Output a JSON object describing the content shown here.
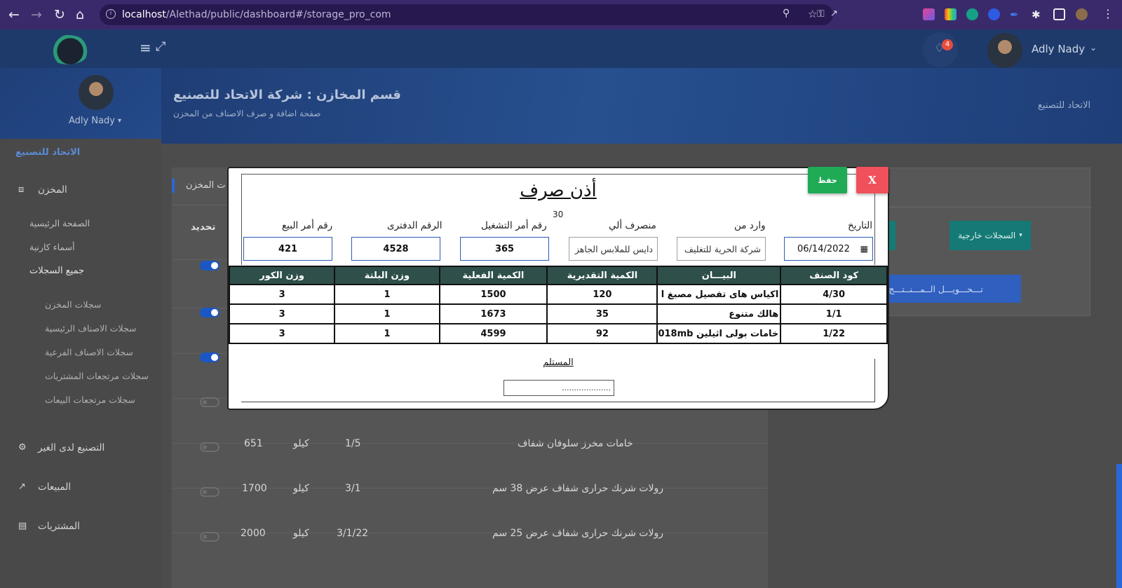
{
  "browser": {
    "url_host": "localhost",
    "url_path": "/Alethad/public/dashboard#/storage_pro_com"
  },
  "topbar": {
    "user_name": "Adly Nady",
    "notification_count": "4"
  },
  "sidebar": {
    "user_name": "Adly Nady",
    "company": "الاتحاد للتصنيع",
    "section_store": "المخزن",
    "store_items": [
      "الصفحة الرئيسية",
      "أسماء كارنية",
      "جميع السجلات"
    ],
    "records_items": [
      "سجلات المخزن",
      "سجلات الاصناف الرئيسية",
      "سجلات الاصناف الفرعية",
      "سجلات مرتجعات المشتريات",
      "سجلات مرتجعات البيعات"
    ],
    "section_outsourcing": "التصنيع لدى الغير",
    "section_sales": "المبيعات",
    "section_purchases": "المشتريات"
  },
  "hero": {
    "title": "قسم المخازن : شركة الاتحاد للتصنيع",
    "subtitle": "صفحة اضافة و صرف الاصناف من المخزن",
    "breadcrumb": "الاتحاد للتصنيع"
  },
  "left_card": {
    "tab_label": "ت المخزن",
    "column_select": "تحديد",
    "rows": [
      {
        "name": "خامات مخرز سلوفان شفاف",
        "code": "1/5",
        "unit": "كيلو",
        "qty": "651"
      },
      {
        "name": "رولات شرنك حرارى شفاف عرض 38 سم",
        "code": "3/1",
        "unit": "كيلو",
        "qty": "1700"
      },
      {
        "name": "رولات شرنك حرارى شفاف عرض 25 سم",
        "code": "3/1/22",
        "unit": "كيلو",
        "qty": "2000"
      }
    ]
  },
  "right_card": {
    "external_records": "السجلات خارجية",
    "transfer_products": "تـــحـــويـــل الــمـــنــتـــج"
  },
  "modal": {
    "title": "أذن صرف",
    "number": "30",
    "save_label": "حفظ",
    "close_label": "X",
    "labels": {
      "date": "التاريخ",
      "from": "وارد من",
      "to": "منصرف ألي",
      "op_no": "رقم أمر التشغيل",
      "book_no": "الرقم الدفترى",
      "sale_no": "رقم أمر البيع"
    },
    "values": {
      "date": "06/14/2022",
      "from": "شركة الحرية للتغليف",
      "to": "دايس للملابس الجاهز",
      "op_no": "365",
      "book_no": "4528",
      "sale_no": "421"
    },
    "table_headers": [
      "كود الصنف",
      "البيـــان",
      "الكمية التقديرية",
      "الكمية الفعلية",
      "وزن البلتة",
      "وزن الكور"
    ],
    "table_rows": [
      [
        "4/30",
        "اكياس هاى تفصيل مصبغ ا",
        "120",
        "1500",
        "1",
        "3"
      ],
      [
        "1/1",
        "هالك متنوع",
        "35",
        "1673",
        "1",
        "3"
      ],
      [
        "1/22",
        "خامات بولى اثيلين 018mb",
        "92",
        "4599",
        "1",
        "3"
      ]
    ],
    "receiver_label": "المستلم",
    "receiver_placeholder": "...................."
  }
}
